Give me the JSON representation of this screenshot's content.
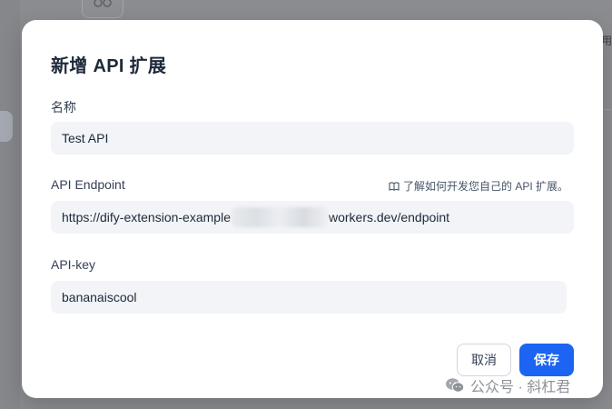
{
  "background": {
    "right_text": "用"
  },
  "modal": {
    "title": "新增 API 扩展",
    "name": {
      "label": "名称",
      "value": "Test API"
    },
    "endpoint": {
      "label": "API Endpoint",
      "help_text": "了解如何开发您自己的 API 扩展。",
      "value_prefix": "https://dify-extension-example",
      "value_suffix": "workers.dev/endpoint"
    },
    "api_key": {
      "label": "API-key",
      "value": "bananaiscool"
    },
    "cancel_label": "取消",
    "save_label": "保存"
  },
  "watermark": {
    "text": "公众号 · 斜杠君"
  },
  "colors": {
    "primary": "#1c64f2",
    "input_bg": "#f2f4f7",
    "overlay": "#8a8c90"
  }
}
